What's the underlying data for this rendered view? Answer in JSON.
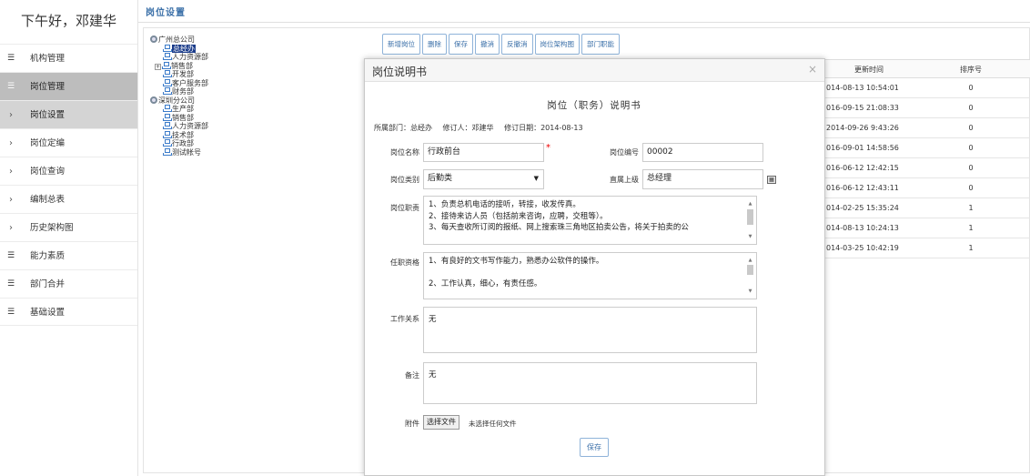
{
  "sidebar": {
    "greeting": "下午好，邓建华",
    "items": [
      {
        "label": "机构管理",
        "icon": "list-icon"
      },
      {
        "label": "岗位管理",
        "icon": "list-icon"
      },
      {
        "label": "岗位设置",
        "icon": "chevron-right-icon"
      },
      {
        "label": "岗位定编",
        "icon": "chevron-right-icon"
      },
      {
        "label": "岗位查询",
        "icon": "chevron-right-icon"
      },
      {
        "label": "编制总表",
        "icon": "chevron-right-icon"
      },
      {
        "label": "历史架构图",
        "icon": "chevron-right-icon"
      },
      {
        "label": "能力素质",
        "icon": "list-icon"
      },
      {
        "label": "部门合并",
        "icon": "list-icon"
      },
      {
        "label": "基础设置",
        "icon": "list-icon"
      }
    ]
  },
  "header": {
    "title": "岗位设置"
  },
  "tree": {
    "nodes": [
      {
        "label": "广州总公司"
      },
      {
        "label": "总经办"
      },
      {
        "label": "人力资源部"
      },
      {
        "label": "销售部"
      },
      {
        "label": "开发部"
      },
      {
        "label": "客户服务部"
      },
      {
        "label": "财务部"
      },
      {
        "label": "深圳分公司"
      },
      {
        "label": "生产部"
      },
      {
        "label": "销售部"
      },
      {
        "label": "人力资源部"
      },
      {
        "label": "技术部"
      },
      {
        "label": "行政部"
      },
      {
        "label": "测试帐号"
      }
    ]
  },
  "toolbar": {
    "buttons": [
      "新增岗位",
      "删除",
      "保存",
      "撤消",
      "反撤消",
      "岗位架构图",
      "部门职能"
    ]
  },
  "table": {
    "headers": [
      "更新时间",
      "排序号"
    ],
    "rows": [
      [
        "014-08-13 10:54:01",
        "0"
      ],
      [
        "016-09-15 21:08:33",
        "0"
      ],
      [
        "2014-09-26 9:43:26",
        "0"
      ],
      [
        "016-09-01 14:58:56",
        "0"
      ],
      [
        "016-06-12 12:42:15",
        "0"
      ],
      [
        "016-06-12 12:43:11",
        "0"
      ],
      [
        "014-02-25 15:35:24",
        "1"
      ],
      [
        "014-08-13 10:24:13",
        "1"
      ],
      [
        "014-03-25 10:42:19",
        "1"
      ]
    ]
  },
  "modal": {
    "title": "岗位说明书",
    "close": "×",
    "doc_title": "岗位（职务）说明书",
    "meta": {
      "dept": "所属部门：总经办",
      "author": "修订人：邓建华",
      "date": "修订日期：2014-08-13"
    },
    "fields": {
      "name_label": "岗位名称",
      "name_value": "行政前台",
      "required_mark": "*",
      "code_label": "岗位编号",
      "code_value": "00002",
      "category_label": "岗位类别",
      "category_value": "后勤类",
      "superior_label": "直属上级",
      "superior_value": "总经理",
      "duty_label": "岗位职责",
      "duty_lines": [
        "1、负责总机电话的接听，转接，收发传真。",
        "2、接待来访人员（包括前来咨询，应聘，交租等）。",
        "3、每天查收所订阅的报纸、网上搜索珠三角地区拍卖公告，将关于拍卖的公"
      ],
      "qual_label": "任职资格",
      "qual_lines": [
        "1、有良好的文书写作能力，熟悉办公软件的操作。",
        "",
        "2、工作认真，细心，有责任感。"
      ],
      "relation_label": "工作关系",
      "relation_value": "无",
      "remark_label": "备注",
      "remark_value": "无",
      "attach_label": "附件",
      "file_button": "选择文件",
      "file_status": "未选择任何文件",
      "save_button": "保存"
    }
  },
  "colors": {
    "accent": "#3a6fa8",
    "active_menu": "#bdbdbd",
    "required": "#ee0000"
  }
}
